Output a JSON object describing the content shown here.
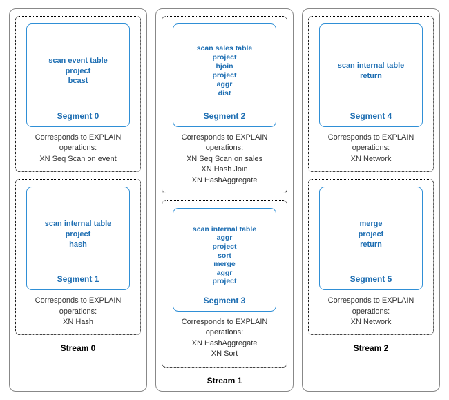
{
  "streams": [
    {
      "label": "Stream 0",
      "segments": [
        {
          "ops": [
            "scan event table",
            "project",
            "bcast"
          ],
          "segment_label": "Segment 0",
          "explain_header": "Corresponds to EXPLAIN operations:",
          "explain_lines": [
            "XN Seq Scan on event"
          ]
        },
        {
          "ops": [
            "scan internal table",
            "project",
            "hash"
          ],
          "segment_label": "Segment 1",
          "explain_header": "Corresponds to EXPLAIN operations:",
          "explain_lines": [
            "XN Hash"
          ]
        }
      ]
    },
    {
      "label": "Stream 1",
      "segments": [
        {
          "ops": [
            "scan sales table",
            "project",
            "hjoin",
            "project",
            "aggr",
            "dist"
          ],
          "segment_label": "Segment 2",
          "explain_header": "Corresponds to EXPLAIN operations:",
          "explain_lines": [
            "XN Seq Scan on sales",
            "XN Hash Join",
            "XN HashAggregate"
          ]
        },
        {
          "ops": [
            "scan internal table",
            "aggr",
            "project",
            "sort",
            "merge",
            "aggr",
            "project"
          ],
          "segment_label": "Segment 3",
          "explain_header": "Corresponds to EXPLAIN operations:",
          "explain_lines": [
            "XN HashAggregate",
            "XN Sort"
          ]
        }
      ]
    },
    {
      "label": "Stream 2",
      "segments": [
        {
          "ops": [
            "scan internal table",
            "return"
          ],
          "segment_label": "Segment 4",
          "explain_header": "Corresponds to EXPLAIN operations:",
          "explain_lines": [
            "XN Network"
          ]
        },
        {
          "ops": [
            "merge",
            "project",
            "return"
          ],
          "segment_label": "Segment 5",
          "explain_header": "Corresponds to EXPLAIN operations:",
          "explain_lines": [
            "XN Network"
          ]
        }
      ]
    }
  ]
}
